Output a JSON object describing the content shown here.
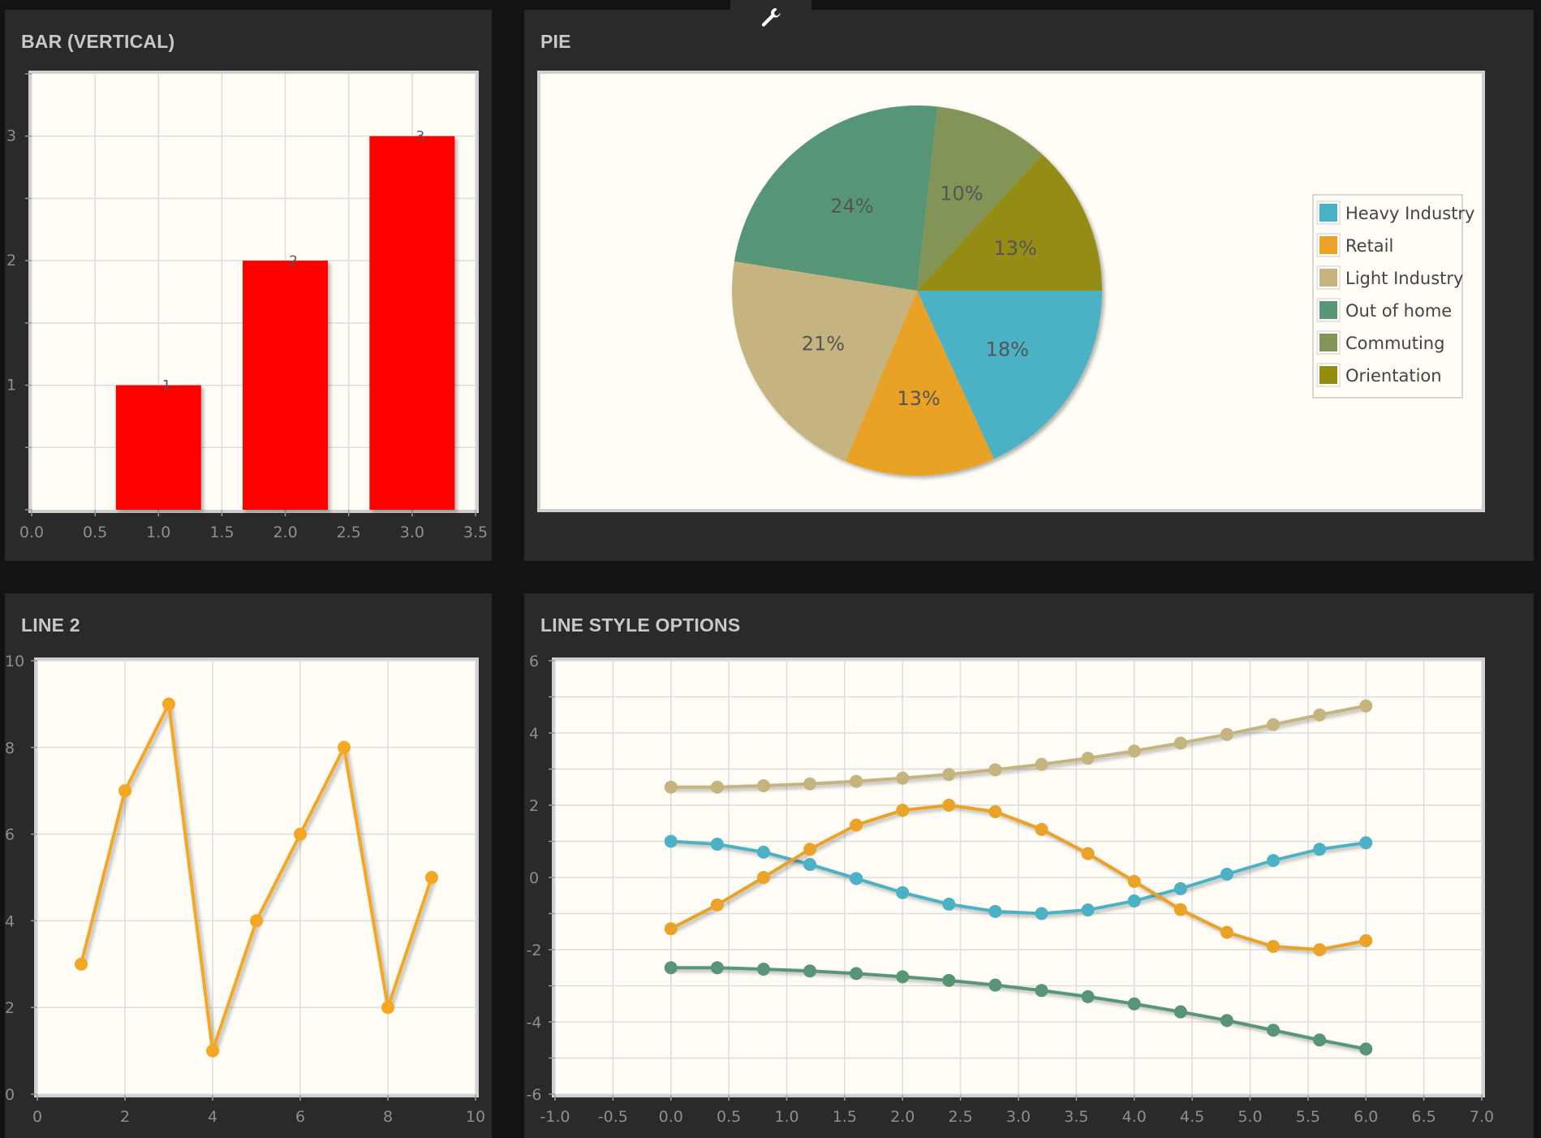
{
  "panels": {
    "bar": {
      "title": "BAR (VERTICAL)"
    },
    "pie": {
      "title": "PIE"
    },
    "line2": {
      "title": "LINE 2"
    },
    "linestyle": {
      "title": "LINE STYLE OPTIONS"
    }
  },
  "toolbar": {
    "icon": "wrench-icon"
  },
  "chart_data": [
    {
      "type": "bar",
      "x": [
        1,
        2,
        3
      ],
      "values": [
        1,
        2,
        3
      ],
      "data_labels": [
        "1",
        "2",
        "3"
      ],
      "xlim": [
        0,
        3.5
      ],
      "ylim": [
        0,
        3.5
      ],
      "xticks": [
        "0.0",
        "0.5",
        "1.0",
        "1.5",
        "2.0",
        "2.5",
        "3.0",
        "3.5"
      ],
      "yticks": [
        {
          "v": 1,
          "label": "1"
        },
        {
          "v": 2,
          "label": "2"
        },
        {
          "v": 3,
          "label": "3"
        }
      ],
      "ygrid": [
        0.5,
        1,
        1.5,
        2,
        2.5,
        3
      ],
      "color": "#ff0000",
      "grid": true
    },
    {
      "type": "pie",
      "slices": [
        {
          "name": "Heavy Industry",
          "value": 18,
          "label": "18%",
          "color": "#4bb2c5"
        },
        {
          "name": "Retail",
          "value": 13,
          "label": "13%",
          "color": "#eaa228"
        },
        {
          "name": "Light Industry",
          "value": 21,
          "label": "21%",
          "color": "#c5b47f"
        },
        {
          "name": "Out of home",
          "value": 24,
          "label": "24%",
          "color": "#579575"
        },
        {
          "name": "Commuting",
          "value": 10,
          "label": "10%",
          "color": "#839557"
        },
        {
          "name": "Orientation",
          "value": 13,
          "label": "13%",
          "color": "#958c12"
        }
      ],
      "legend": "right"
    },
    {
      "type": "line",
      "x": [
        1,
        2,
        3,
        4,
        5,
        6,
        7,
        8,
        9
      ],
      "series": [
        {
          "values": [
            3,
            7,
            9,
            1,
            4,
            6,
            8,
            2,
            5
          ],
          "color": "#f5a623"
        }
      ],
      "xlim": [
        0,
        10
      ],
      "ylim": [
        0,
        10
      ],
      "xticks": [
        "0",
        "2",
        "4",
        "6",
        "8",
        "10"
      ],
      "yticks": [
        "0",
        "2",
        "4",
        "6",
        "8",
        "10"
      ],
      "grid": true
    },
    {
      "type": "line",
      "x": [
        0,
        0.4,
        0.8,
        1.2,
        1.6,
        2.0,
        2.4,
        2.8,
        3.2,
        3.6,
        4.0,
        4.4,
        4.8,
        5.2,
        5.6,
        6.0
      ],
      "series": [
        {
          "color": "#c5b47f",
          "values": [
            2.5,
            2.5,
            2.54,
            2.59,
            2.66,
            2.75,
            2.85,
            2.98,
            3.13,
            3.3,
            3.5,
            3.72,
            3.96,
            4.23,
            4.5,
            4.75
          ]
        },
        {
          "color": "#4bb2c5",
          "values": [
            1.0,
            0.92,
            0.7,
            0.36,
            -0.03,
            -0.42,
            -0.74,
            -0.94,
            -1.0,
            -0.9,
            -0.65,
            -0.31,
            0.09,
            0.47,
            0.78,
            0.96
          ]
        },
        {
          "color": "#eaa228",
          "values": [
            -1.42,
            -0.76,
            0.0,
            0.78,
            1.45,
            1.86,
            2.0,
            1.82,
            1.33,
            0.66,
            -0.11,
            -0.89,
            -1.52,
            -1.91,
            -2.0,
            -1.75
          ]
        },
        {
          "color": "#579575",
          "values": [
            -2.5,
            -2.5,
            -2.54,
            -2.59,
            -2.66,
            -2.75,
            -2.85,
            -2.98,
            -3.13,
            -3.3,
            -3.5,
            -3.72,
            -3.96,
            -4.23,
            -4.5,
            -4.75
          ]
        }
      ],
      "xlim": [
        -1,
        7
      ],
      "ylim": [
        -6,
        6
      ],
      "xticks": [
        "-1.0",
        "-0.5",
        "0.0",
        "0.5",
        "1.0",
        "1.5",
        "2.0",
        "2.5",
        "3.0",
        "3.5",
        "4.0",
        "4.5",
        "5.0",
        "5.5",
        "6.0",
        "6.5",
        "7.0"
      ],
      "yticks": [
        "-6",
        "-4",
        "-2",
        "0",
        "2",
        "4",
        "6"
      ],
      "grid": true
    }
  ]
}
